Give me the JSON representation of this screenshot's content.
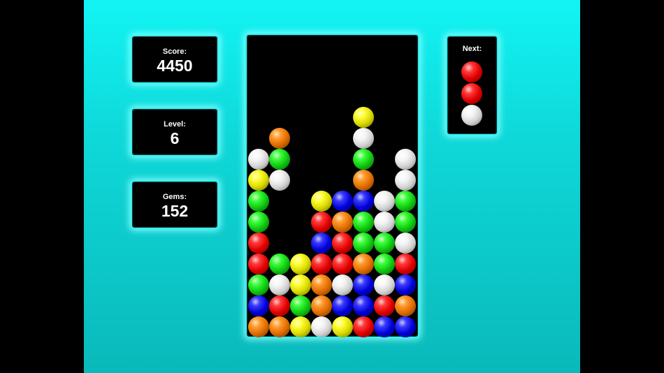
{
  "score": {
    "label": "Score:",
    "value": "4450"
  },
  "level": {
    "label": "Level:",
    "value": "6"
  },
  "gems": {
    "label": "Gems:",
    "value": "152"
  },
  "next": {
    "label": "Next:",
    "pieces": [
      "red",
      "red",
      "white"
    ]
  },
  "board": {
    "columns": 8,
    "rows": 14,
    "cells": [
      {
        "c": 5,
        "r": 4,
        "color": "yellow"
      },
      {
        "c": 1,
        "r": 5,
        "color": "orange"
      },
      {
        "c": 5,
        "r": 5,
        "color": "white"
      },
      {
        "c": 0,
        "r": 6,
        "color": "white"
      },
      {
        "c": 1,
        "r": 6,
        "color": "green"
      },
      {
        "c": 5,
        "r": 6,
        "color": "green"
      },
      {
        "c": 7,
        "r": 6,
        "color": "white"
      },
      {
        "c": 0,
        "r": 7,
        "color": "yellow"
      },
      {
        "c": 1,
        "r": 7,
        "color": "white"
      },
      {
        "c": 5,
        "r": 7,
        "color": "orange"
      },
      {
        "c": 7,
        "r": 7,
        "color": "white"
      },
      {
        "c": 0,
        "r": 8,
        "color": "green"
      },
      {
        "c": 3,
        "r": 8,
        "color": "yellow"
      },
      {
        "c": 4,
        "r": 8,
        "color": "blue"
      },
      {
        "c": 5,
        "r": 8,
        "color": "blue"
      },
      {
        "c": 6,
        "r": 8,
        "color": "white"
      },
      {
        "c": 7,
        "r": 8,
        "color": "green"
      },
      {
        "c": 0,
        "r": 9,
        "color": "green"
      },
      {
        "c": 3,
        "r": 9,
        "color": "red"
      },
      {
        "c": 4,
        "r": 9,
        "color": "orange"
      },
      {
        "c": 5,
        "r": 9,
        "color": "green"
      },
      {
        "c": 6,
        "r": 9,
        "color": "white"
      },
      {
        "c": 7,
        "r": 9,
        "color": "green"
      },
      {
        "c": 0,
        "r": 10,
        "color": "red"
      },
      {
        "c": 3,
        "r": 10,
        "color": "blue"
      },
      {
        "c": 4,
        "r": 10,
        "color": "red"
      },
      {
        "c": 5,
        "r": 10,
        "color": "green"
      },
      {
        "c": 6,
        "r": 10,
        "color": "green"
      },
      {
        "c": 7,
        "r": 10,
        "color": "white"
      },
      {
        "c": 0,
        "r": 11,
        "color": "red"
      },
      {
        "c": 1,
        "r": 11,
        "color": "green"
      },
      {
        "c": 2,
        "r": 11,
        "color": "yellow"
      },
      {
        "c": 3,
        "r": 11,
        "color": "red"
      },
      {
        "c": 4,
        "r": 11,
        "color": "red"
      },
      {
        "c": 5,
        "r": 11,
        "color": "orange"
      },
      {
        "c": 6,
        "r": 11,
        "color": "green"
      },
      {
        "c": 7,
        "r": 11,
        "color": "red"
      },
      {
        "c": 0,
        "r": 12,
        "color": "green"
      },
      {
        "c": 1,
        "r": 12,
        "color": "white"
      },
      {
        "c": 2,
        "r": 12,
        "color": "yellow"
      },
      {
        "c": 3,
        "r": 12,
        "color": "orange"
      },
      {
        "c": 4,
        "r": 12,
        "color": "white"
      },
      {
        "c": 5,
        "r": 12,
        "color": "blue"
      },
      {
        "c": 6,
        "r": 12,
        "color": "white"
      },
      {
        "c": 7,
        "r": 12,
        "color": "blue"
      },
      {
        "c": 0,
        "r": 13,
        "color": "blue"
      },
      {
        "c": 1,
        "r": 13,
        "color": "red"
      },
      {
        "c": 2,
        "r": 13,
        "color": "green"
      },
      {
        "c": 3,
        "r": 13,
        "color": "orange"
      },
      {
        "c": 4,
        "r": 13,
        "color": "blue"
      },
      {
        "c": 5,
        "r": 13,
        "color": "blue"
      },
      {
        "c": 6,
        "r": 13,
        "color": "red"
      },
      {
        "c": 7,
        "r": 13,
        "color": "orange"
      },
      {
        "c": 0,
        "r": 14,
        "color": "orange"
      },
      {
        "c": 1,
        "r": 14,
        "color": "orange"
      },
      {
        "c": 2,
        "r": 14,
        "color": "yellow"
      },
      {
        "c": 3,
        "r": 14,
        "color": "white"
      },
      {
        "c": 4,
        "r": 14,
        "color": "yellow"
      },
      {
        "c": 5,
        "r": 14,
        "color": "red"
      },
      {
        "c": 6,
        "r": 14,
        "color": "blue"
      },
      {
        "c": 7,
        "r": 14,
        "color": "blue"
      }
    ]
  },
  "colors": {
    "background_top": "#12f4f4",
    "background_bottom": "#0ab9ba",
    "panel_glow": "#30f4f4"
  }
}
